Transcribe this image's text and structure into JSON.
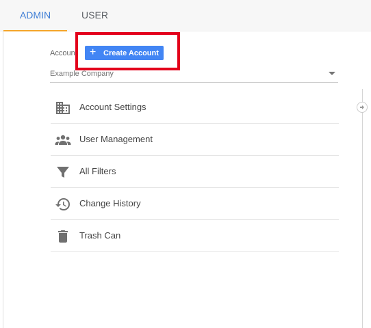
{
  "tabs": [
    {
      "label": "ADMIN"
    },
    {
      "label": "USER"
    }
  ],
  "account": {
    "label": "Account",
    "create_button_label": "Create Account",
    "selected_company": "Example Company"
  },
  "menu": [
    {
      "label": "Account Settings",
      "icon": "building-icon"
    },
    {
      "label": "User Management",
      "icon": "people-icon"
    },
    {
      "label": "All Filters",
      "icon": "filter-icon"
    },
    {
      "label": "Change History",
      "icon": "history-icon"
    },
    {
      "label": "Trash Can",
      "icon": "trash-icon"
    }
  ],
  "colors": {
    "accent": "#4285f4",
    "tab_active_text": "#3a7bd5",
    "tab_underline": "#f4a52a",
    "highlight": "#e3001b",
    "icon": "#707070"
  }
}
